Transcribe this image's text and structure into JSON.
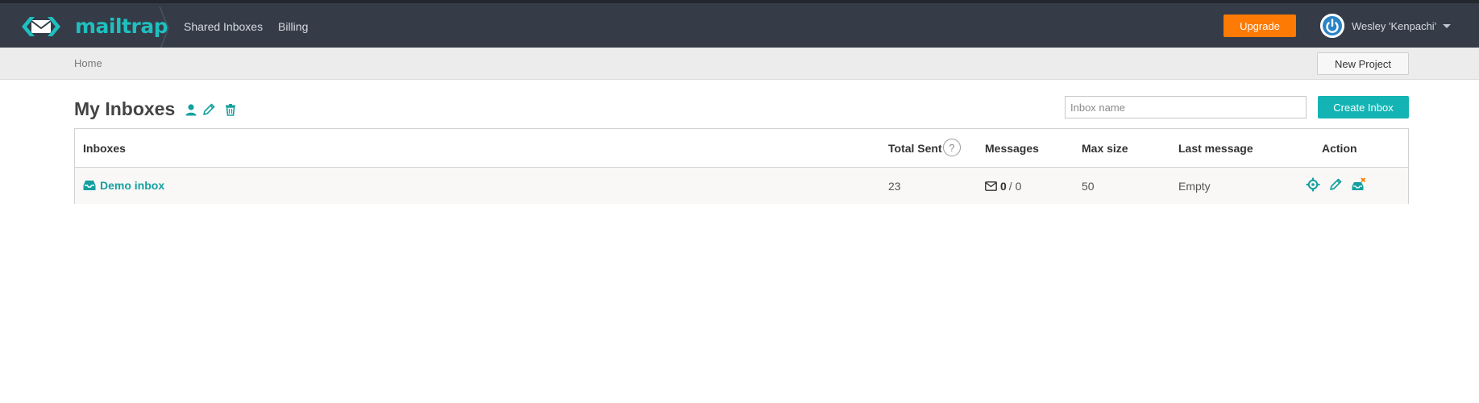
{
  "app": {
    "brand": "mailtrap",
    "nav": [
      "Shared Inboxes",
      "Billing"
    ],
    "upgrade_label": "Upgrade",
    "user_name": "Wesley 'Kenpachi'"
  },
  "breadcrumb": {
    "home": "Home",
    "new_project_label": "New Project"
  },
  "page": {
    "title": "My Inboxes",
    "search_placeholder": "Inbox name",
    "create_label": "Create Inbox"
  },
  "table": {
    "columns": {
      "inboxes": "Inboxes",
      "total_sent": "Total Sent",
      "help": "?",
      "messages": "Messages",
      "max_size": "Max size",
      "last_message": "Last message",
      "action": "Action"
    },
    "rows": [
      {
        "name": "Demo inbox",
        "total_sent": "23",
        "messages_unread": "0",
        "messages_total": "/ 0",
        "max_size": "50",
        "last_message": "Empty"
      }
    ]
  },
  "colors": {
    "nav_bg": "#353c47",
    "accent": "#14b4b4",
    "upgrade": "#fd7a04"
  },
  "icons": {
    "title_actions": [
      "user-icon",
      "pencil-icon",
      "trash-icon"
    ],
    "row_actions": [
      "settings-icon",
      "pencil-icon",
      "clear-inbox-icon"
    ]
  }
}
